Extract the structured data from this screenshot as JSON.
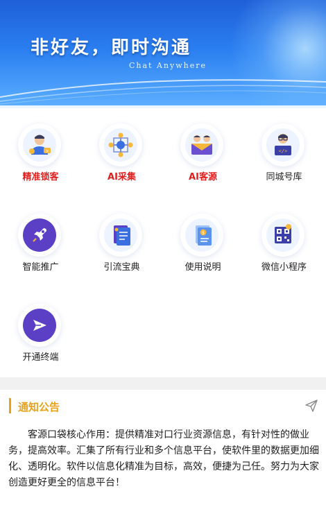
{
  "banner": {
    "headline": "非好友，即时沟通",
    "subline": "Chat Anywhere"
  },
  "grid": {
    "items": [
      {
        "label": "精准锁客",
        "icon": "precise-lock-icon",
        "highlight": true
      },
      {
        "label": "AI采集",
        "icon": "ai-collect-icon",
        "highlight": true
      },
      {
        "label": "AI客源",
        "icon": "ai-customers-icon",
        "highlight": true
      },
      {
        "label": "同城号库",
        "icon": "city-number-library-icon",
        "highlight": false
      },
      {
        "label": "智能推广",
        "icon": "rocket-icon",
        "highlight": false
      },
      {
        "label": "引流宝典",
        "icon": "document-icon",
        "highlight": false
      },
      {
        "label": "使用说明",
        "icon": "manual-icon",
        "highlight": false
      },
      {
        "label": "微信小程序",
        "icon": "qr-code-icon",
        "highlight": false
      },
      {
        "label": "开通终端",
        "icon": "send-icon",
        "highlight": false
      }
    ]
  },
  "notice": {
    "title": "通知公告",
    "body": "客源口袋核心作用：提供精准对口行业资源信息，有针对性的做业务，提高效率。汇集了所有行业和多个信息平台，使软件里的数据更加细化、透明化。软件以信息化精准为目标，高效，便捷为己任。努力为大家创造更好更全的信息平台！"
  },
  "colors": {
    "accent_red": "#e0201f",
    "notice_gold": "#e6a21a",
    "banner_blue": "#2a7ef0",
    "icon_purple": "#5b3fc4"
  }
}
